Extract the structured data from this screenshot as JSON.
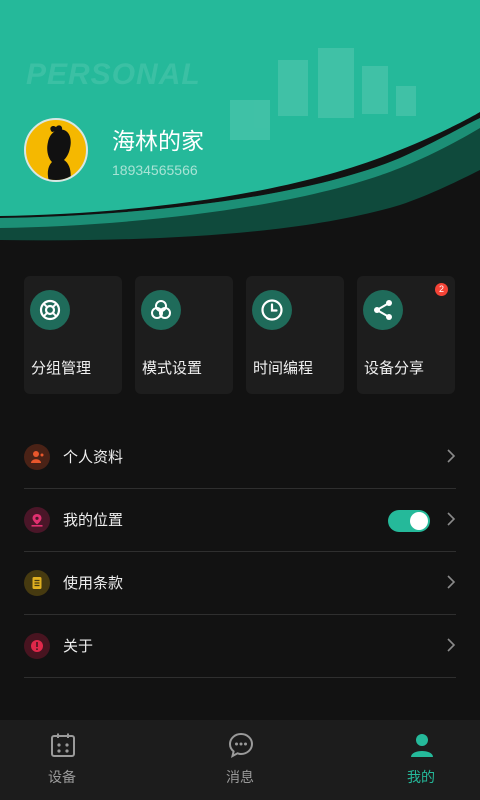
{
  "header": {
    "watermark": "PERSONAL",
    "user_name": "海林的家",
    "phone": "18934565566"
  },
  "quick_actions": [
    {
      "label": "分组管理",
      "icon": "lifebuoy-icon"
    },
    {
      "label": "模式设置",
      "icon": "circles-icon"
    },
    {
      "label": "时间编程",
      "icon": "clock-icon"
    },
    {
      "label": "设备分享",
      "icon": "share-icon",
      "badge": "2"
    }
  ],
  "menu": [
    {
      "label": "个人资料",
      "icon": "profile-icon",
      "icon_color": "#e8572c"
    },
    {
      "label": "我的位置",
      "icon": "location-icon",
      "icon_color": "#e03070",
      "toggle_on": true
    },
    {
      "label": "使用条款",
      "icon": "document-icon",
      "icon_color": "#e0b020"
    },
    {
      "label": "关于",
      "icon": "info-icon",
      "icon_color": "#e0284a"
    }
  ],
  "tabs": [
    {
      "label": "设备",
      "icon": "devices-icon",
      "active": false
    },
    {
      "label": "消息",
      "icon": "message-icon",
      "active": false
    },
    {
      "label": "我的",
      "icon": "user-icon",
      "active": true
    }
  ],
  "colors": {
    "accent": "#25b99a",
    "background": "#121212",
    "card": "#1d1d1d"
  }
}
